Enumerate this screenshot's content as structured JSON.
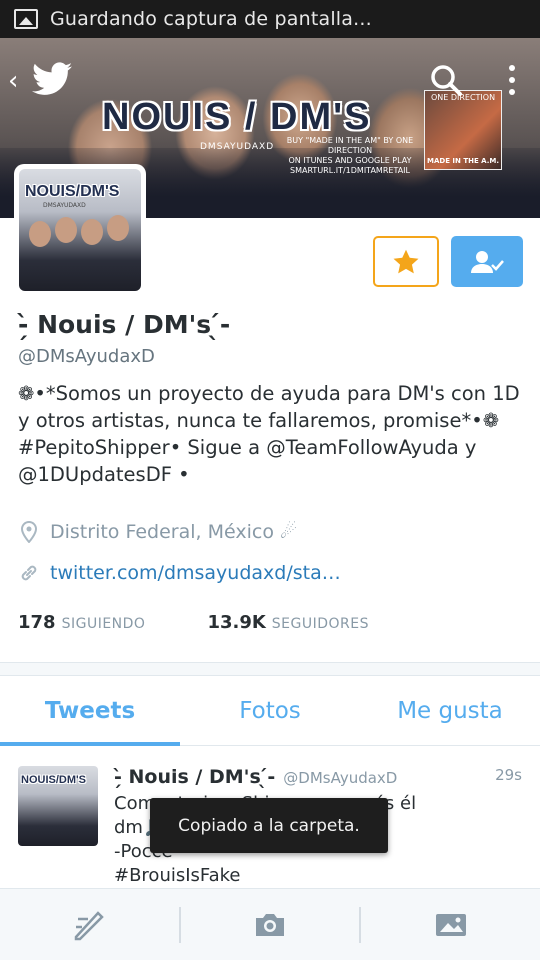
{
  "status_bar": {
    "text": "Guardando captura de pantalla..."
  },
  "banner": {
    "title": "NOUIS / DM'S",
    "subtitle": "DMSAYUDAXD",
    "promo_lines": [
      "BUY \"MADE IN THE AM\" BY ONE DIRECTION",
      "ON ITUNES AND GOOGLE PLAY",
      "SMARTURL.IT/1DMITAMRETAIL"
    ],
    "album_top": "ONE DIRECTION",
    "album_label": "MADE IN THE A.M."
  },
  "nav": {
    "back_icon": "chevron-left-icon",
    "logo_icon": "twitter-bird-icon",
    "search_icon": "search-icon",
    "more_icon": "overflow-menu-icon"
  },
  "avatar": {
    "title": "NOUIS/DM'S",
    "subtitle": "DMSAYUDAXD"
  },
  "actions": {
    "star_icon": "star-icon",
    "follow_icon": "user-check-icon",
    "star_color": "#f4a51a",
    "follow_color": "#55acee"
  },
  "profile": {
    "name": "-̗̀ Nouis / DM's ̖́-",
    "handle": "@DMsAyudaxD",
    "bio": "❁•*Somos un proyecto de ayuda para DM's con 1D y otros artistas, nunca te fallaremos, promise*•❁ #PepitoShipper• Sigue a @TeamFollowAyuda y @1DUpdatesDF •",
    "location": "Distrito Federal, México ☄",
    "link": "twitter.com/dmsayudaxd/sta…"
  },
  "stats": {
    "following_count": "178",
    "following_label": "SIGUIENDO",
    "followers_count": "13.9K",
    "followers_label": "SEGUIDORES"
  },
  "tabs": [
    {
      "label": "Tweets",
      "active": true
    },
    {
      "label": "Fotos",
      "active": false
    },
    {
      "label": "Me gusta",
      "active": false
    }
  ],
  "tweet": {
    "avatar_title": "NOUIS/DM'S",
    "name": "-̗̀ Nouis / DM's ̖́-",
    "handle": "@DMsAyudaxD",
    "time": "29s",
    "line1": "Comentario... Shipper y querés él",
    "line2": "dm🎵",
    "line3": "-Pocce",
    "line4": "#BrouisIsFake"
  },
  "toast": {
    "text": "Copiado a la carpeta."
  },
  "bottom_bar": {
    "items": [
      "compose-icon",
      "camera-icon",
      "image-icon"
    ]
  },
  "colors": {
    "accent": "#55acee",
    "link": "#2b7bb9",
    "muted": "#8899a6",
    "text": "#292f33"
  }
}
